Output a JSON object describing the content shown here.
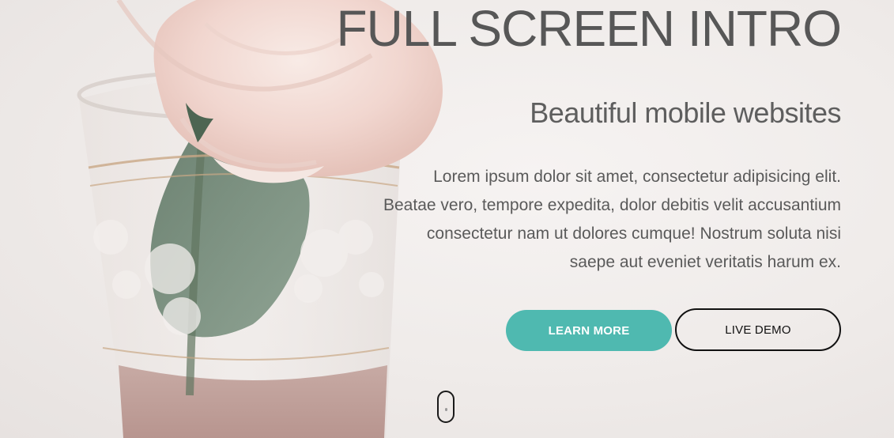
{
  "hero": {
    "title": "FULL SCREEN INTRO",
    "subtitle": "Beautiful mobile websites",
    "body_lines": [
      "Lorem ipsum dolor sit amet, consectetur adipisicing elit.",
      "Beatae vero, tempore expedita, dolor debitis velit accusantium",
      "consectetur nam ut dolores cumque! Nostrum soluta nisi",
      "saepe aut eveniet veritatis harum ex."
    ],
    "background_image": "rose-in-glass-photo"
  },
  "buttons": {
    "learn_more": "LEARN MORE",
    "live_demo": "LIVE DEMO"
  },
  "scroll": {
    "icon": "mouse-scroll-icon"
  },
  "colors": {
    "accent": "#4fb9b0",
    "text": "#575757",
    "outline": "#111111"
  }
}
